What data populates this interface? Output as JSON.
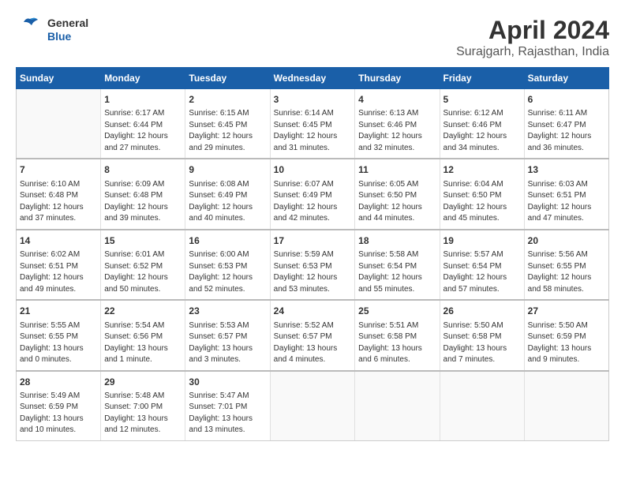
{
  "header": {
    "logo_line1": "General",
    "logo_line2": "Blue",
    "month": "April 2024",
    "location": "Surajgarh, Rajasthan, India"
  },
  "columns": [
    "Sunday",
    "Monday",
    "Tuesday",
    "Wednesday",
    "Thursday",
    "Friday",
    "Saturday"
  ],
  "weeks": [
    [
      {
        "num": "",
        "info": ""
      },
      {
        "num": "1",
        "info": "Sunrise: 6:17 AM\nSunset: 6:44 PM\nDaylight: 12 hours\nand 27 minutes."
      },
      {
        "num": "2",
        "info": "Sunrise: 6:15 AM\nSunset: 6:45 PM\nDaylight: 12 hours\nand 29 minutes."
      },
      {
        "num": "3",
        "info": "Sunrise: 6:14 AM\nSunset: 6:45 PM\nDaylight: 12 hours\nand 31 minutes."
      },
      {
        "num": "4",
        "info": "Sunrise: 6:13 AM\nSunset: 6:46 PM\nDaylight: 12 hours\nand 32 minutes."
      },
      {
        "num": "5",
        "info": "Sunrise: 6:12 AM\nSunset: 6:46 PM\nDaylight: 12 hours\nand 34 minutes."
      },
      {
        "num": "6",
        "info": "Sunrise: 6:11 AM\nSunset: 6:47 PM\nDaylight: 12 hours\nand 36 minutes."
      }
    ],
    [
      {
        "num": "7",
        "info": "Sunrise: 6:10 AM\nSunset: 6:48 PM\nDaylight: 12 hours\nand 37 minutes."
      },
      {
        "num": "8",
        "info": "Sunrise: 6:09 AM\nSunset: 6:48 PM\nDaylight: 12 hours\nand 39 minutes."
      },
      {
        "num": "9",
        "info": "Sunrise: 6:08 AM\nSunset: 6:49 PM\nDaylight: 12 hours\nand 40 minutes."
      },
      {
        "num": "10",
        "info": "Sunrise: 6:07 AM\nSunset: 6:49 PM\nDaylight: 12 hours\nand 42 minutes."
      },
      {
        "num": "11",
        "info": "Sunrise: 6:05 AM\nSunset: 6:50 PM\nDaylight: 12 hours\nand 44 minutes."
      },
      {
        "num": "12",
        "info": "Sunrise: 6:04 AM\nSunset: 6:50 PM\nDaylight: 12 hours\nand 45 minutes."
      },
      {
        "num": "13",
        "info": "Sunrise: 6:03 AM\nSunset: 6:51 PM\nDaylight: 12 hours\nand 47 minutes."
      }
    ],
    [
      {
        "num": "14",
        "info": "Sunrise: 6:02 AM\nSunset: 6:51 PM\nDaylight: 12 hours\nand 49 minutes."
      },
      {
        "num": "15",
        "info": "Sunrise: 6:01 AM\nSunset: 6:52 PM\nDaylight: 12 hours\nand 50 minutes."
      },
      {
        "num": "16",
        "info": "Sunrise: 6:00 AM\nSunset: 6:53 PM\nDaylight: 12 hours\nand 52 minutes."
      },
      {
        "num": "17",
        "info": "Sunrise: 5:59 AM\nSunset: 6:53 PM\nDaylight: 12 hours\nand 53 minutes."
      },
      {
        "num": "18",
        "info": "Sunrise: 5:58 AM\nSunset: 6:54 PM\nDaylight: 12 hours\nand 55 minutes."
      },
      {
        "num": "19",
        "info": "Sunrise: 5:57 AM\nSunset: 6:54 PM\nDaylight: 12 hours\nand 57 minutes."
      },
      {
        "num": "20",
        "info": "Sunrise: 5:56 AM\nSunset: 6:55 PM\nDaylight: 12 hours\nand 58 minutes."
      }
    ],
    [
      {
        "num": "21",
        "info": "Sunrise: 5:55 AM\nSunset: 6:55 PM\nDaylight: 13 hours\nand 0 minutes."
      },
      {
        "num": "22",
        "info": "Sunrise: 5:54 AM\nSunset: 6:56 PM\nDaylight: 13 hours\nand 1 minute."
      },
      {
        "num": "23",
        "info": "Sunrise: 5:53 AM\nSunset: 6:57 PM\nDaylight: 13 hours\nand 3 minutes."
      },
      {
        "num": "24",
        "info": "Sunrise: 5:52 AM\nSunset: 6:57 PM\nDaylight: 13 hours\nand 4 minutes."
      },
      {
        "num": "25",
        "info": "Sunrise: 5:51 AM\nSunset: 6:58 PM\nDaylight: 13 hours\nand 6 minutes."
      },
      {
        "num": "26",
        "info": "Sunrise: 5:50 AM\nSunset: 6:58 PM\nDaylight: 13 hours\nand 7 minutes."
      },
      {
        "num": "27",
        "info": "Sunrise: 5:50 AM\nSunset: 6:59 PM\nDaylight: 13 hours\nand 9 minutes."
      }
    ],
    [
      {
        "num": "28",
        "info": "Sunrise: 5:49 AM\nSunset: 6:59 PM\nDaylight: 13 hours\nand 10 minutes."
      },
      {
        "num": "29",
        "info": "Sunrise: 5:48 AM\nSunset: 7:00 PM\nDaylight: 13 hours\nand 12 minutes."
      },
      {
        "num": "30",
        "info": "Sunrise: 5:47 AM\nSunset: 7:01 PM\nDaylight: 13 hours\nand 13 minutes."
      },
      {
        "num": "",
        "info": ""
      },
      {
        "num": "",
        "info": ""
      },
      {
        "num": "",
        "info": ""
      },
      {
        "num": "",
        "info": ""
      }
    ]
  ]
}
